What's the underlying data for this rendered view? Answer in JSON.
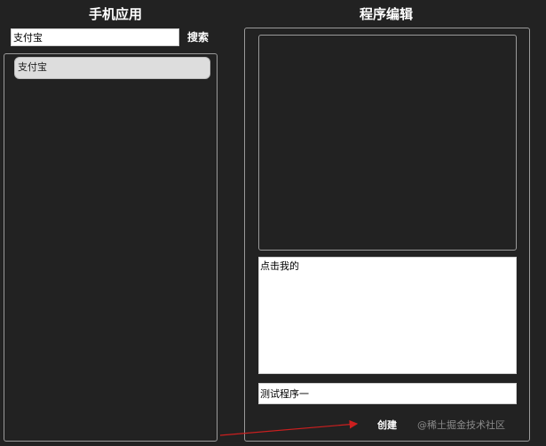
{
  "left": {
    "title": "手机应用",
    "search": {
      "value": "支付宝",
      "button_label": "搜索"
    },
    "results": [
      {
        "label": "支付宝"
      }
    ]
  },
  "right": {
    "title": "程序编辑",
    "code_text": "点击我的",
    "program_name": "测试程序一",
    "create_label": "创建"
  },
  "watermark": "@稀土掘金技术社区",
  "colors": {
    "background": "#222222",
    "border": "#9a9a9a",
    "arrow": "#cc1f1f",
    "item_bg": "#dddddd"
  }
}
